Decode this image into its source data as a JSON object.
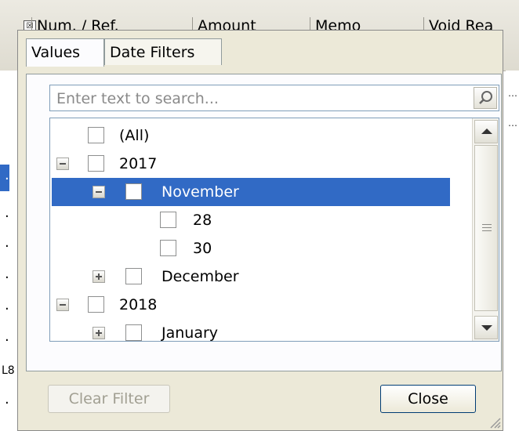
{
  "grid": {
    "columns": [
      "Num. / Ref.",
      "Amount",
      "Memo",
      "Void Rea"
    ],
    "left_row_marks": [
      "·",
      "·",
      "·",
      "·",
      "·",
      "·",
      "L8",
      "·"
    ]
  },
  "popup": {
    "tabs": [
      {
        "label": "Values",
        "active": true
      },
      {
        "label": "Date Filters",
        "active": false
      }
    ],
    "search": {
      "placeholder": "Enter text to search...",
      "value": ""
    },
    "tree": [
      {
        "label": "(All)",
        "level": 0,
        "expander": "none",
        "checked": false,
        "selected": false
      },
      {
        "label": "2017",
        "level": 0,
        "expander": "minus",
        "checked": false,
        "selected": false
      },
      {
        "label": "November",
        "level": 1,
        "expander": "minus",
        "checked": false,
        "selected": true
      },
      {
        "label": "28",
        "level": 2,
        "expander": "none",
        "checked": false,
        "selected": false
      },
      {
        "label": "30",
        "level": 2,
        "expander": "none",
        "checked": false,
        "selected": false
      },
      {
        "label": "December",
        "level": 1,
        "expander": "plus",
        "checked": false,
        "selected": false
      },
      {
        "label": "2018",
        "level": 0,
        "expander": "minus",
        "checked": false,
        "selected": false
      },
      {
        "label": "January",
        "level": 1,
        "expander": "plus",
        "checked": false,
        "selected": false
      }
    ],
    "buttons": {
      "clear_filter": "Clear Filter",
      "close": "Close"
    },
    "colors": {
      "selection": "#316ac5",
      "dialog_bg": "#ece9d8"
    }
  }
}
